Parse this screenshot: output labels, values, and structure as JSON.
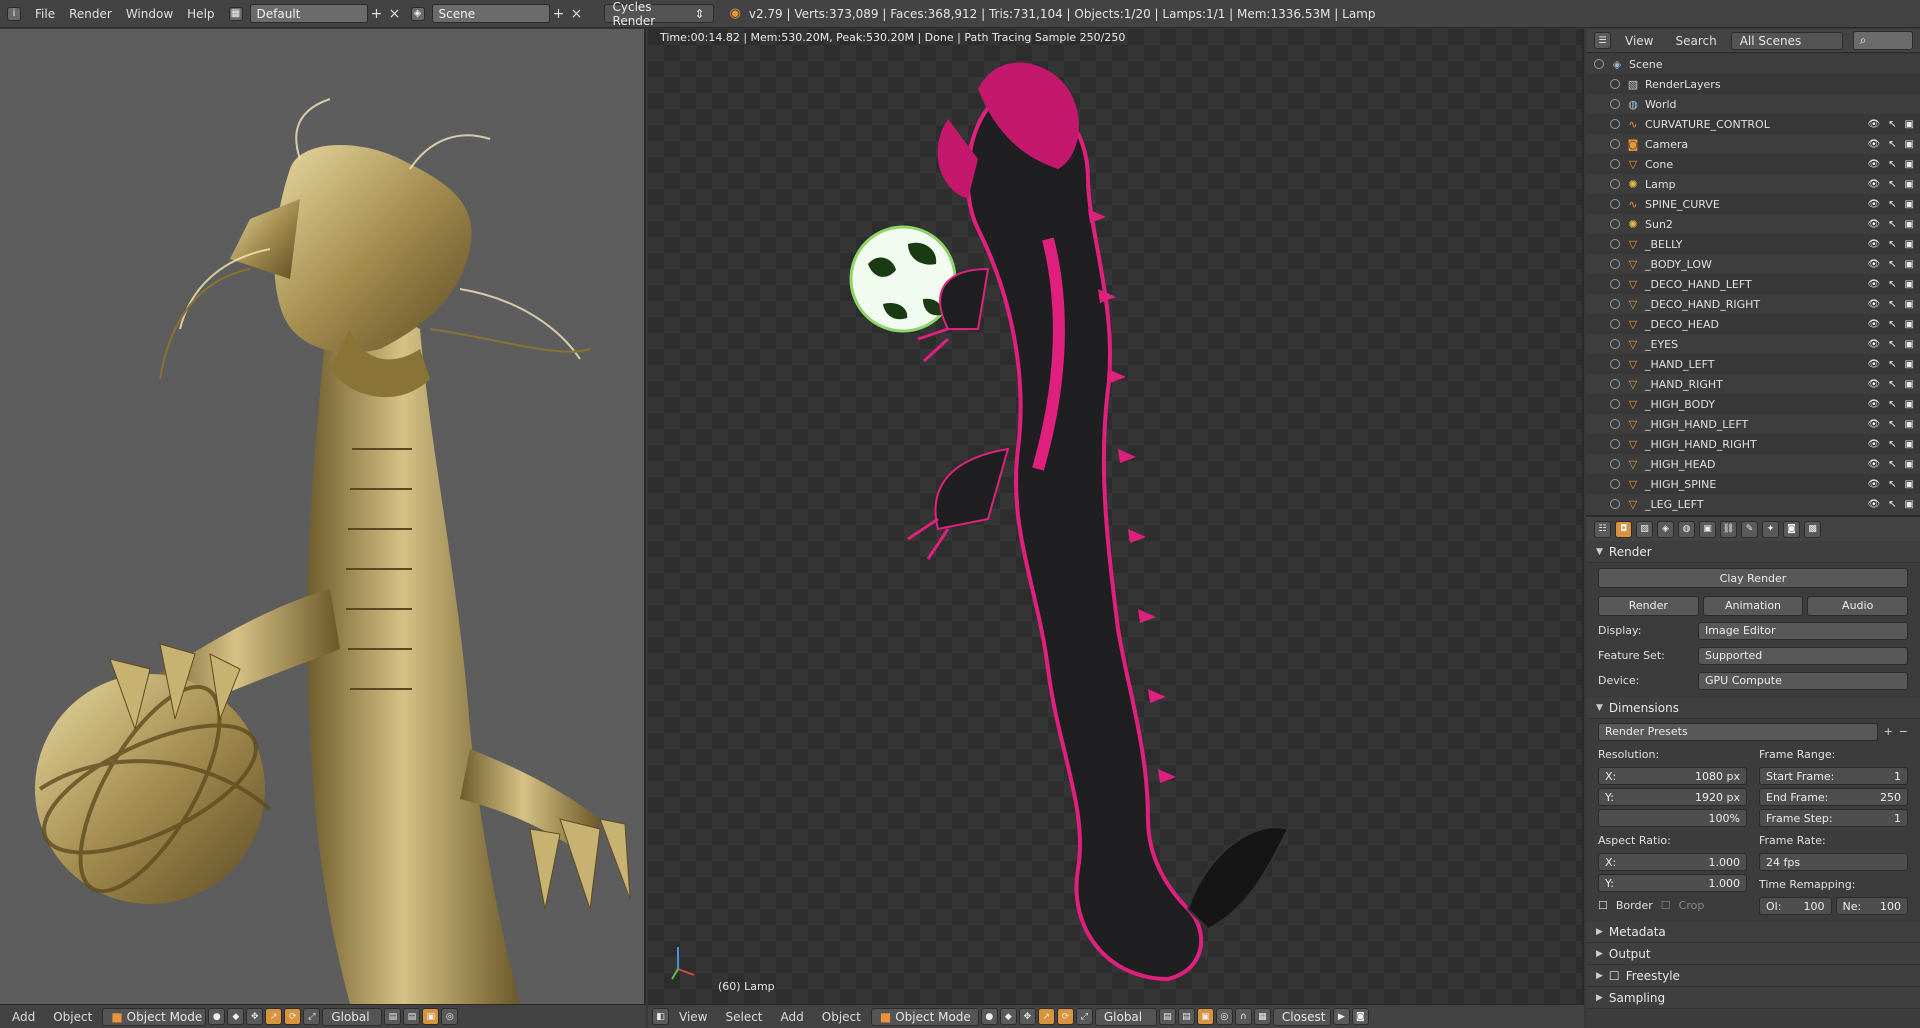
{
  "topbar": {
    "menus": [
      "File",
      "Render",
      "Window",
      "Help"
    ],
    "layout": "Default",
    "scene": "Scene",
    "engine": "Cycles Render",
    "stats": "v2.79 | Verts:373,089 | Faces:368,912 | Tris:731,104 | Objects:1/20 | Lamps:1/1 | Mem:1336.53M | Lamp"
  },
  "left_view": {
    "header": {
      "items": [
        "Add",
        "Object"
      ],
      "mode": "Object Mode",
      "orientation": "Global"
    }
  },
  "render_view": {
    "info": "Time:00:14.82 | Mem:530.20M, Peak:530.20M | Done | Path Tracing Sample 250/250",
    "frame_label": "(60) Lamp",
    "header": {
      "items": [
        "View",
        "Select",
        "Add",
        "Object"
      ],
      "mode": "Object Mode",
      "orientation": "Global",
      "snap": "Closest"
    }
  },
  "outliner": {
    "header": {
      "view": "View",
      "search": "Search",
      "filter": "All Scenes"
    },
    "rows": [
      {
        "name": "Scene",
        "icon": "scene-icon",
        "level": 0
      },
      {
        "name": "RenderLayers",
        "icon": "renderlayers-icon",
        "level": 1
      },
      {
        "name": "World",
        "icon": "world-icon",
        "level": 1
      },
      {
        "name": "CURVATURE_CONTROL",
        "icon": "curve-icon",
        "level": 1
      },
      {
        "name": "Camera",
        "icon": "camera-icon",
        "level": 1
      },
      {
        "name": "Cone",
        "icon": "mesh-icon",
        "level": 1
      },
      {
        "name": "Lamp",
        "icon": "lamp-icon",
        "level": 1
      },
      {
        "name": "SPINE_CURVE",
        "icon": "curve-icon",
        "level": 1
      },
      {
        "name": "Sun2",
        "icon": "lamp-icon",
        "level": 1
      },
      {
        "name": "_BELLY",
        "icon": "mesh-icon",
        "level": 1
      },
      {
        "name": "_BODY_LOW",
        "icon": "mesh-icon",
        "level": 1
      },
      {
        "name": "_DECO_HAND_LEFT",
        "icon": "mesh-icon",
        "level": 1
      },
      {
        "name": "_DECO_HAND_RIGHT",
        "icon": "mesh-icon",
        "level": 1
      },
      {
        "name": "_DECO_HEAD",
        "icon": "mesh-icon",
        "level": 1
      },
      {
        "name": "_EYES",
        "icon": "mesh-icon",
        "level": 1
      },
      {
        "name": "_HAND_LEFT",
        "icon": "mesh-icon",
        "level": 1
      },
      {
        "name": "_HAND_RIGHT",
        "icon": "mesh-icon",
        "level": 1
      },
      {
        "name": "_HIGH_BODY",
        "icon": "mesh-icon",
        "level": 1
      },
      {
        "name": "_HIGH_HAND_LEFT",
        "icon": "mesh-icon",
        "level": 1
      },
      {
        "name": "_HIGH_HAND_RIGHT",
        "icon": "mesh-icon",
        "level": 1
      },
      {
        "name": "_HIGH_HEAD",
        "icon": "mesh-icon",
        "level": 1
      },
      {
        "name": "_HIGH_SPINE",
        "icon": "mesh-icon",
        "level": 1
      },
      {
        "name": "_LEG_LEFT",
        "icon": "mesh-icon",
        "level": 1
      }
    ]
  },
  "properties": {
    "render_panel": {
      "title": "Render",
      "clay_button": "Clay Render",
      "buttons": [
        "Render",
        "Animation",
        "Audio"
      ],
      "display_label": "Display:",
      "display_value": "Image Editor",
      "feature_label": "Feature Set:",
      "feature_value": "Supported",
      "device_label": "Device:",
      "device_value": "GPU Compute"
    },
    "dimensions_panel": {
      "title": "Dimensions",
      "presets": "Render Presets",
      "resolution_label": "Resolution:",
      "res_x_label": "X:",
      "res_x": "1080 px",
      "res_y_label": "Y:",
      "res_y": "1920 px",
      "res_pct": "100%",
      "aspect_label": "Aspect Ratio:",
      "asp_x_label": "X:",
      "asp_x": "1.000",
      "asp_y_label": "Y:",
      "asp_y": "1.000",
      "border": "Border",
      "crop": "Crop",
      "frame_range_label": "Frame Range:",
      "start_label": "Start Frame:",
      "start": "1",
      "end_label": "End Frame:",
      "end": "250",
      "step_label": "Frame Step:",
      "step": "1",
      "frame_rate_label": "Frame Rate:",
      "frame_rate": "24 fps",
      "remap_label": "Time Remapping:",
      "old_label": "Ol:",
      "old": "100",
      "new_label": "Ne:",
      "new": "100"
    },
    "collapsed_panels": [
      "Metadata",
      "Output",
      "Freestyle",
      "Sampling"
    ]
  },
  "colors": {
    "accent_orange": "#d8943c",
    "dragon_magenta": "#e0207e",
    "gold": "#b9a46a"
  }
}
